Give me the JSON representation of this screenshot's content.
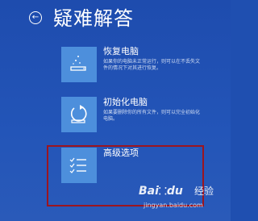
{
  "header": {
    "back_glyph": "←",
    "title": "疑难解答"
  },
  "options": [
    {
      "title": "恢复电脑",
      "description": "如果你的电脑未正常运行，则可以在不丢失文件的情况下对其进行恢复。",
      "icon": "restore-icon"
    },
    {
      "title": "初始化电脑",
      "description": "如果要删除你的所有文件，则可以完全初始化电脑。",
      "icon": "reset-icon"
    },
    {
      "title": "高级选项",
      "icon": "checklist-icon"
    }
  ],
  "colors": {
    "background": "#1f4fb0",
    "tile": "#4d8fdc",
    "highlight_border": "#9b1520"
  },
  "watermark": {
    "logo_a": "Bai",
    "logo_paw": "⸬",
    "logo_b": "du",
    "tagline": "经验",
    "url": "jingyan.baidu.com"
  }
}
